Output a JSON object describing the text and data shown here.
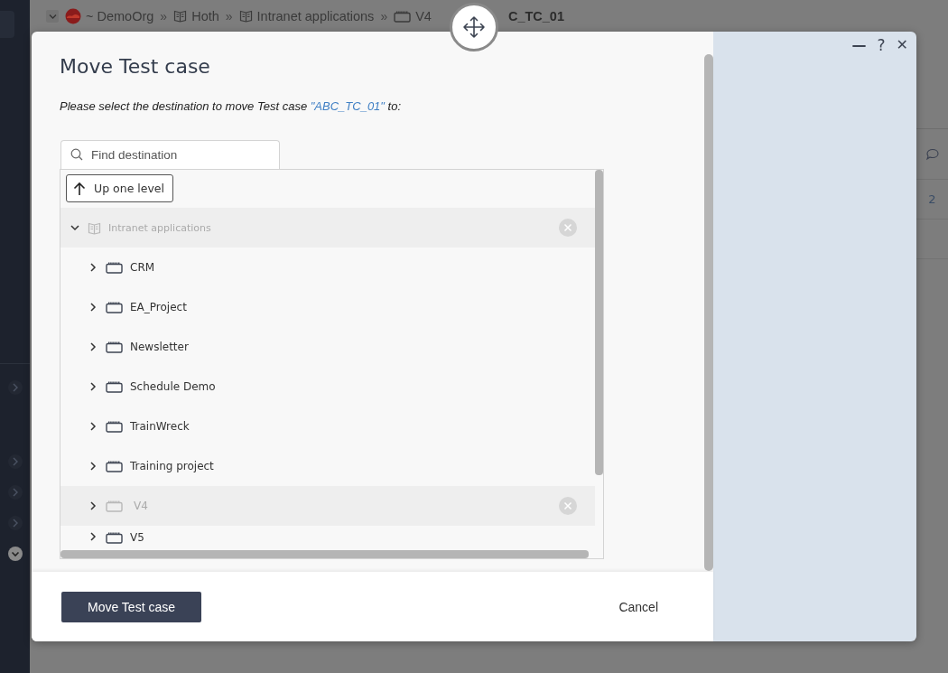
{
  "breadcrumb": {
    "separator": "»",
    "items": [
      {
        "label": "~ DemoOrg",
        "kind": "org"
      },
      {
        "label": "Hoth",
        "kind": "book"
      },
      {
        "label": "Intranet applications",
        "kind": "book"
      },
      {
        "label": "V4",
        "kind": "folder"
      },
      {
        "label": "C_TC_01",
        "kind": "plain"
      }
    ]
  },
  "window_buttons": [
    {
      "label": "—",
      "kind": "minimize"
    },
    {
      "label": "?",
      "kind": "help"
    },
    {
      "label": "✕",
      "kind": "close"
    }
  ],
  "background": {
    "count": "2"
  },
  "dialog": {
    "title": "Move Test case",
    "prompt": "Please select the destination to move Test case ",
    "target": "\"ABC_TC_01\"",
    "prompt_end": " to:",
    "search": {
      "placeholder": "Find destination"
    },
    "up_button": "Up one level",
    "tree": [
      {
        "label": "Intranet applications",
        "kind": "book",
        "expanded": true,
        "disabled": true,
        "children": [
          {
            "label": "CRM",
            "kind": "folder",
            "expanded": false,
            "disabled": false
          },
          {
            "label": "EA_Project",
            "kind": "folder",
            "expanded": false,
            "disabled": false
          },
          {
            "label": "Newsletter",
            "kind": "folder",
            "expanded": false,
            "disabled": false
          },
          {
            "label": "Schedule Demo",
            "kind": "folder",
            "expanded": false,
            "disabled": false
          },
          {
            "label": "TrainWreck",
            "kind": "folder",
            "expanded": false,
            "disabled": false
          },
          {
            "label": "Training project",
            "kind": "folder",
            "expanded": false,
            "disabled": false
          },
          {
            "label": "V4",
            "kind": "folder",
            "expanded": false,
            "disabled": true
          },
          {
            "label": "V5",
            "kind": "folder",
            "expanded": false,
            "disabled": false
          }
        ]
      }
    ],
    "buttons": [
      {
        "label": "Move Test case",
        "kind": "primary"
      },
      {
        "label": "Cancel",
        "kind": "link"
      }
    ]
  }
}
